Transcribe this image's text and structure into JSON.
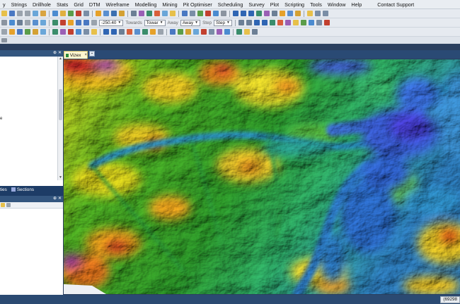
{
  "menu": [
    "y",
    "Strings",
    "Drillhole",
    "Stats",
    "Grid",
    "DTM",
    "Wireframe",
    "Modelling",
    "Mining",
    "Pit Optimiser",
    "Scheduling",
    "Survey",
    "Plot",
    "Scripting",
    "Tools",
    "Window",
    "Help",
    "Contact Support"
  ],
  "toolbar": {
    "angle_value": "-250.40",
    "toward_label": "Towards",
    "toward_value": "Towar",
    "away_label": "Away",
    "away_value": "Away",
    "step_label": "Step",
    "step_value": "Step"
  },
  "left_panel": {
    "partial_text": "e",
    "tabs": [
      "ties",
      "Sections"
    ]
  },
  "viewport": {
    "tab_label": "Vizex",
    "tab_close": "×",
    "new_tab_icon": "folder-icon"
  },
  "statusbar": {
    "coordinate": "(69298"
  }
}
